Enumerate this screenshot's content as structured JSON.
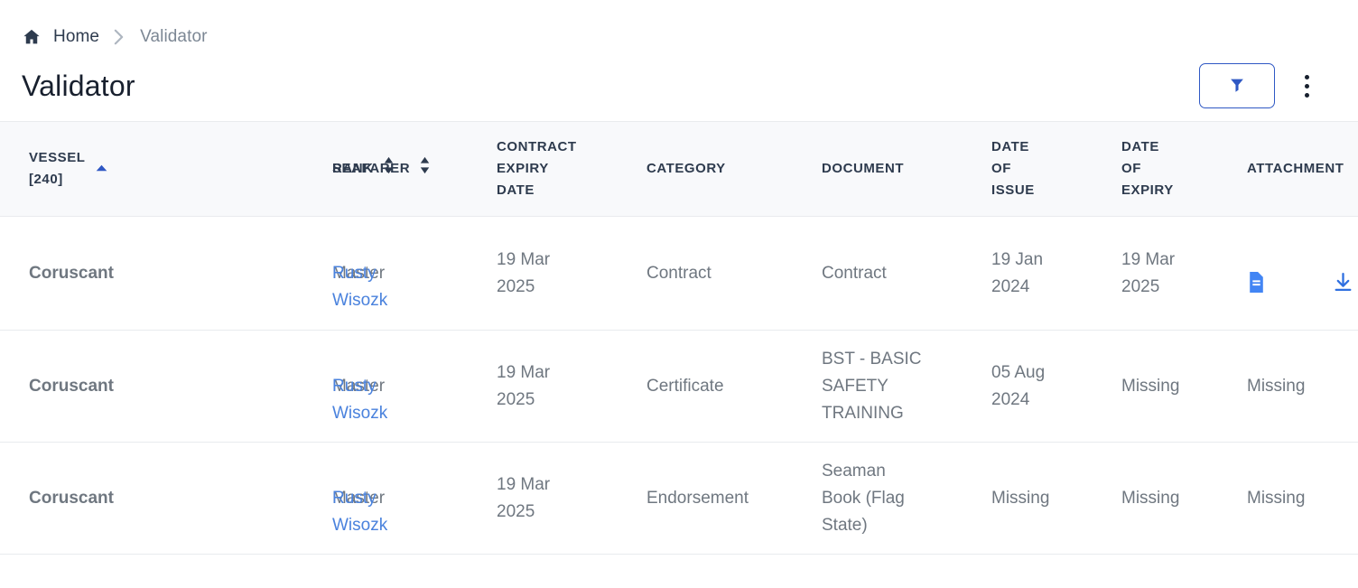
{
  "breadcrumb": {
    "home_icon": "home-icon",
    "home_label": "Home",
    "separator_icon": "chevron-right-icon",
    "current_label": "Validator"
  },
  "header": {
    "title": "Validator",
    "filter_button": {
      "icon": "filter-funnel-icon",
      "label": ""
    },
    "overflow_button": {
      "icon": "more-vertical-icon",
      "label": ""
    }
  },
  "table": {
    "columns": [
      {
        "label": "VESSEL\n[240]",
        "sort": "ascending",
        "sort_icon": "sort-ascending-icon"
      },
      {
        "label": "RANK",
        "sort": "none",
        "sort_icon": "sort-both-icon"
      },
      {
        "label": "SEAFARER",
        "sort": "none",
        "sort_icon": "sort-both-icon"
      },
      {
        "label": "CONTRACT\nEXPIRY\nDATE",
        "sort": null,
        "sort_icon": ""
      },
      {
        "label": "CATEGORY",
        "sort": null,
        "sort_icon": ""
      },
      {
        "label": "DOCUMENT",
        "sort": null,
        "sort_icon": ""
      },
      {
        "label": "DATE\nOF\nISSUE",
        "sort": null,
        "sort_icon": ""
      },
      {
        "label": "DATE\nOF\nEXPIRY",
        "sort": null,
        "sort_icon": ""
      },
      {
        "label": "ATTACHMENT",
        "sort": null,
        "sort_icon": ""
      }
    ],
    "rows": [
      {
        "vessel": "Coruscant",
        "rank": "Master",
        "seafarer": "Rusty\nWisozk",
        "contract_expiry_date": "19 Mar\n2025",
        "category": "Contract",
        "document": "Contract",
        "date_of_issue": "19 Jan\n2024",
        "date_of_expiry": "19 Mar\n2025",
        "attachment": {
          "type": "icons",
          "text": "",
          "icons": [
            "file-document-icon",
            "download-icon"
          ]
        }
      },
      {
        "vessel": "Coruscant",
        "rank": "Master",
        "seafarer": "Rusty\nWisozk",
        "contract_expiry_date": "19 Mar\n2025",
        "category": "Certificate",
        "document": "BST - BASIC\nSAFETY\nTRAINING",
        "date_of_issue": "05 Aug\n2024",
        "date_of_expiry": "Missing",
        "attachment": {
          "type": "text",
          "text": "Missing",
          "icons": []
        }
      },
      {
        "vessel": "Coruscant",
        "rank": "Master",
        "seafarer": "Rusty\nWisozk",
        "contract_expiry_date": "19 Mar\n2025",
        "category": "Endorsement",
        "document": "Seaman\nBook (Flag\nState)",
        "date_of_issue": "Missing",
        "date_of_expiry": "Missing",
        "attachment": {
          "type": "text",
          "text": "Missing",
          "icons": []
        }
      }
    ]
  },
  "colors": {
    "accent_blue": "#2f58c4",
    "link_blue": "#4a82dd",
    "icon_blue": "#4285f4",
    "missing_red": "#e0453a",
    "header_bg": "#f8f9fb",
    "text_dark": "#18202e",
    "text_muted": "#6f7780"
  }
}
